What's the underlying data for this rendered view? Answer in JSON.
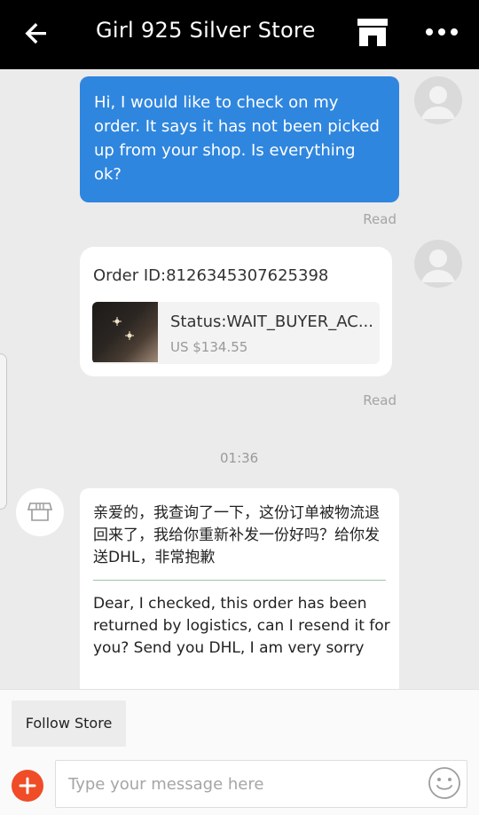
{
  "header": {
    "title": "Girl 925 Silver Store",
    "back_icon": "arrow-left-icon",
    "store_icon": "storefront-icon",
    "more_icon": "more-dots-icon"
  },
  "messages": {
    "outgoing_text": "Hi, I would like to check on my order. It says it has not been picked up from your shop. Is everything ok?",
    "outgoing_status": "Read",
    "order_card": {
      "order_id": "Order ID:8126345307625398",
      "status": "Status:WAIT_BUYER_AC...",
      "price": "US $134.55",
      "read_status": "Read"
    },
    "timestamp": "01:36",
    "incoming_cn": "亲爱的，我查询了一下，这份订单被物流退回来了，我给你重新补发一份好吗？给你发送DHL，非常抱歉",
    "incoming_en": "Dear, I checked, this order has been returned by logistics, can I resend it for you? Send you DHL, I am very sorry"
  },
  "footer": {
    "follow_label": "Follow Store",
    "input_placeholder": "Type your message here",
    "plus_icon": "plus-icon",
    "emoji_icon": "smiley-icon"
  },
  "colors": {
    "header_bg": "#000000",
    "outgoing_bubble": "#2f86de",
    "plus_button": "#ef4c27",
    "background": "#ebebeb"
  }
}
